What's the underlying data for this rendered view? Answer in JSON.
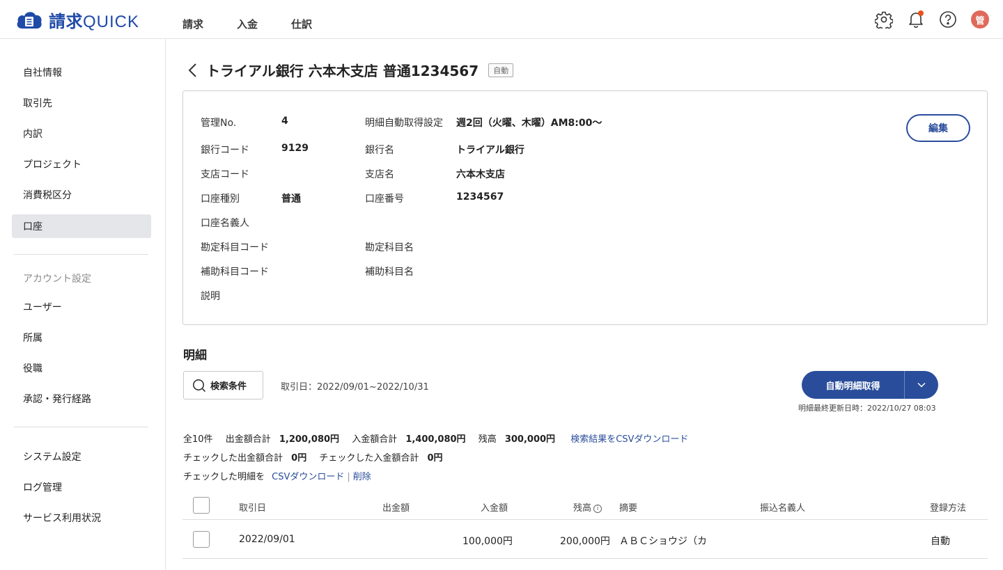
{
  "app": {
    "name_kanji": "請求",
    "name_latin": "QUICK"
  },
  "topnav": [
    {
      "label": "請求"
    },
    {
      "label": "入金"
    },
    {
      "label": "仕訳"
    }
  ],
  "header": {
    "icons": [
      "gear-icon",
      "bell-icon",
      "help-icon"
    ],
    "avatar_initial": "管",
    "notification_dot_color": "#e8501e"
  },
  "sidebar": {
    "items": [
      {
        "label": "自社情報"
      },
      {
        "label": "取引先"
      },
      {
        "label": "内訳"
      },
      {
        "label": "プロジェクト"
      },
      {
        "label": "消費税区分"
      },
      {
        "label": "口座",
        "active": true
      }
    ],
    "account_section_label": "アカウント設定",
    "account_items": [
      {
        "label": "ユーザー"
      },
      {
        "label": "所属"
      },
      {
        "label": "役職"
      },
      {
        "label": "承認・発行経路"
      }
    ],
    "system_items": [
      {
        "label": "システム設定"
      },
      {
        "label": "ログ管理"
      },
      {
        "label": "サービス利用状況"
      }
    ]
  },
  "page": {
    "title": "トライアル銀行 六本木支店 普通1234567",
    "badge": "自動"
  },
  "info": {
    "left": [
      {
        "label": "管理No.",
        "value": "4"
      },
      {
        "label": "銀行コード",
        "value": "9129"
      },
      {
        "label": "支店コード",
        "value": ""
      },
      {
        "label": "口座種別",
        "value": "普通"
      },
      {
        "label": "口座名義人",
        "value": ""
      },
      {
        "label": "勘定科目コード",
        "value": ""
      },
      {
        "label": "補助科目コード",
        "value": ""
      },
      {
        "label": "説明",
        "value": ""
      }
    ],
    "right": [
      {
        "label": "明細自動取得設定",
        "value": "週2回（火曜、木曜）AM8:00～"
      },
      {
        "label": "銀行名",
        "value": "トライアル銀行"
      },
      {
        "label": "支店名",
        "value": "六本木支店"
      },
      {
        "label": "口座番号",
        "value": "1234567"
      },
      {
        "label": "勘定科目名",
        "value": ""
      },
      {
        "label": "補助科目名",
        "value": ""
      }
    ],
    "edit_label": "編集"
  },
  "details": {
    "section_title": "明細",
    "search_label": "検索条件",
    "date_range": "取引日：2022/09/01~2022/10/31",
    "auto_fetch_label": "自動明細取得",
    "last_updated": "明細最終更新日時：2022/10/27 08:03",
    "summary": {
      "total_count": "全10件",
      "withdrawal_total_label": "出金額合計",
      "withdrawal_total": "1,200,080円",
      "deposit_total_label": "入金額合計",
      "deposit_total": "1,400,080円",
      "balance_label": "残高",
      "balance": "300,000円",
      "csv_search_link": "検索結果をCSVダウンロード",
      "checked_withdrawal_label": "チェックした出金額合計",
      "checked_withdrawal": "0円",
      "checked_deposit_label": "チェックした入金額合計",
      "checked_deposit": "0円",
      "checked_prefix": "チェックした明細を",
      "csv_link": "CSVダウンロード",
      "delete_link": "削除"
    },
    "columns": [
      "取引日",
      "出金額",
      "入金額",
      "残高",
      "摘要",
      "振込名義人",
      "登録方法"
    ],
    "rows": [
      {
        "date": "2022/09/01",
        "withdrawal": "",
        "deposit": "100,000円",
        "balance": "200,000円",
        "memo": "ＡＢＣショウジ（カ",
        "payer": "",
        "method": "自動"
      }
    ]
  },
  "colors": {
    "brand": "#1f4aa8",
    "primary_button": "#2a4d9b",
    "active_sidebar": "#e4e6ea"
  }
}
